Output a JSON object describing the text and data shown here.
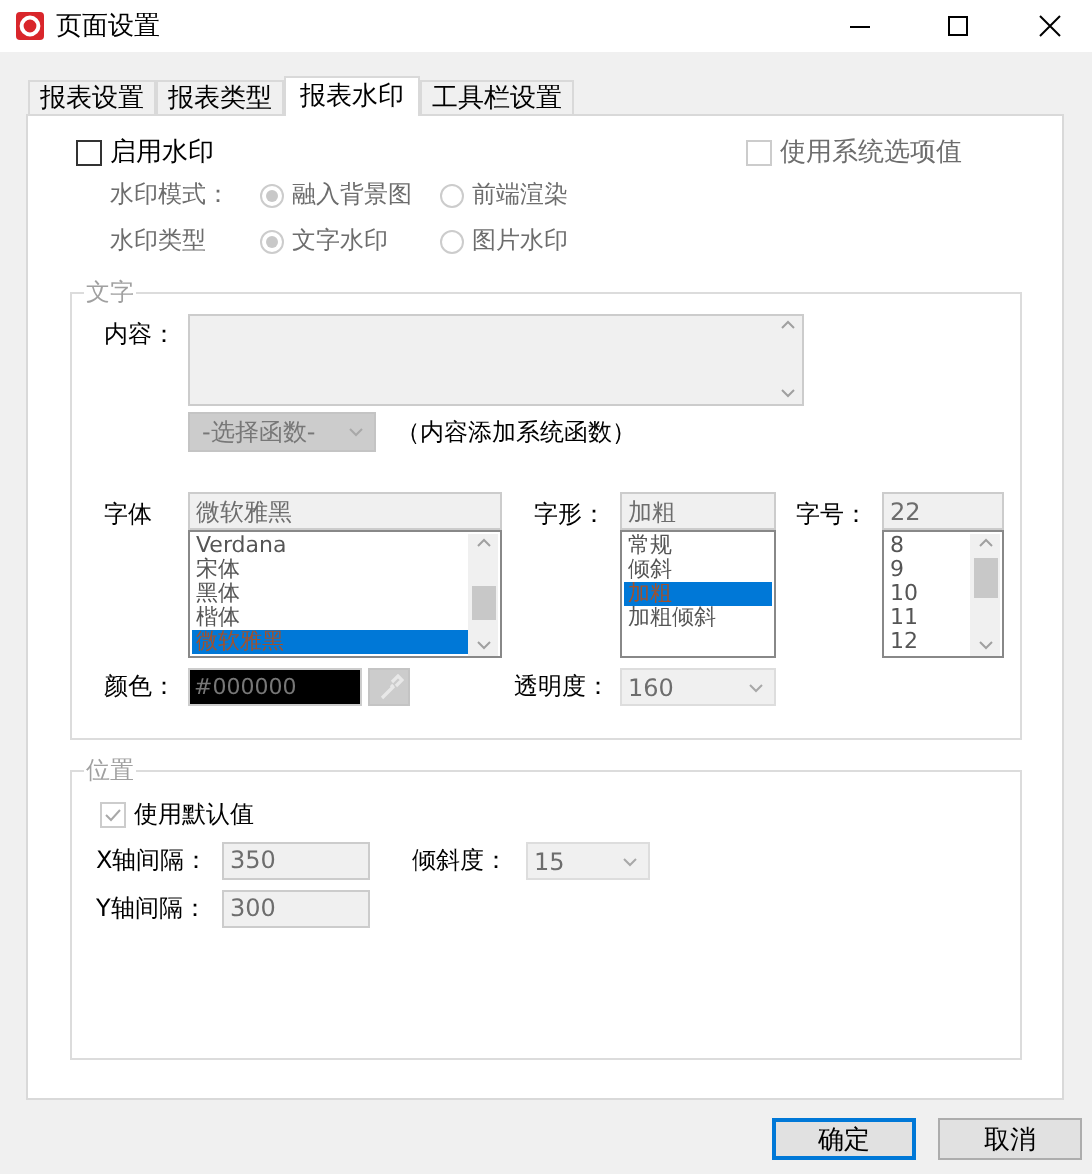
{
  "window": {
    "title": "页面设置"
  },
  "tabs": [
    {
      "label": "报表设置",
      "selected": false
    },
    {
      "label": "报表类型",
      "selected": false
    },
    {
      "label": "报表水印",
      "selected": true
    },
    {
      "label": "工具栏设置",
      "selected": false
    }
  ],
  "enable_watermark": {
    "label": "启用水印",
    "checked": false
  },
  "use_system_options": {
    "label": "使用系统选项值",
    "checked": false,
    "disabled": true
  },
  "watermark_mode": {
    "label": "水印模式：",
    "options": [
      {
        "label": "融入背景图",
        "selected": true
      },
      {
        "label": "前端渲染",
        "selected": false
      }
    ]
  },
  "watermark_type": {
    "label": "水印类型",
    "options": [
      {
        "label": "文字水印",
        "selected": true
      },
      {
        "label": "图片水印",
        "selected": false
      }
    ]
  },
  "text_group": {
    "legend": "文字",
    "content_label": "内容：",
    "function_select": "-选择函数-",
    "function_note": "（内容添加系统函数）",
    "font": {
      "label": "字体",
      "value": "微软雅黑",
      "items": [
        {
          "label": "Verdana",
          "selected": false
        },
        {
          "label": "宋体",
          "selected": false
        },
        {
          "label": "黑体",
          "selected": false
        },
        {
          "label": "楷体",
          "selected": false
        },
        {
          "label": "微软雅黑",
          "selected": true
        }
      ]
    },
    "style": {
      "label": "字形：",
      "value": "加粗",
      "items": [
        {
          "label": "常规",
          "selected": false
        },
        {
          "label": "倾斜",
          "selected": false
        },
        {
          "label": "加粗",
          "selected": true
        },
        {
          "label": "加粗倾斜",
          "selected": false
        }
      ]
    },
    "size": {
      "label": "字号：",
      "value": "22",
      "items": [
        {
          "label": "8",
          "selected": false
        },
        {
          "label": "9",
          "selected": false
        },
        {
          "label": "10",
          "selected": false
        },
        {
          "label": "11",
          "selected": false
        },
        {
          "label": "12",
          "selected": false
        }
      ]
    },
    "color": {
      "label": "颜色：",
      "value": "#000000"
    },
    "opacity": {
      "label": "透明度：",
      "value": "160"
    }
  },
  "position_group": {
    "legend": "位置",
    "use_default": {
      "label": "使用默认值",
      "checked": true
    },
    "x_spacing": {
      "label": "X轴间隔：",
      "value": "350"
    },
    "y_spacing": {
      "label": "Y轴间隔：",
      "value": "300"
    },
    "tilt": {
      "label": "倾斜度：",
      "value": "15"
    }
  },
  "buttons": [
    {
      "label": "确定",
      "default": true
    },
    {
      "label": "取消",
      "default": false
    }
  ]
}
